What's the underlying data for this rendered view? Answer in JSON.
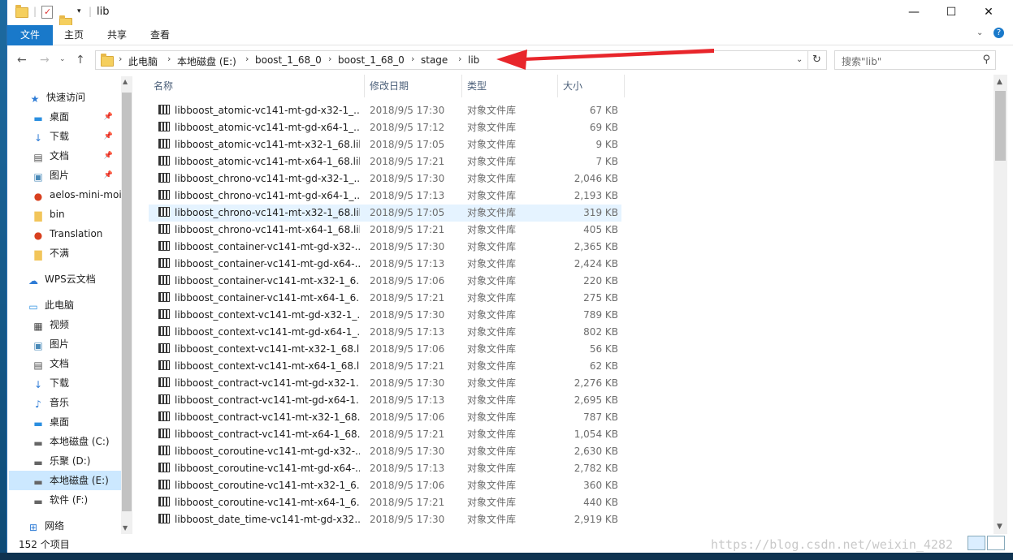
{
  "window": {
    "title": "lib",
    "minimize": "—",
    "maximize": "☐",
    "close": "✕"
  },
  "ribbon": {
    "tabs": [
      "文件",
      "主页",
      "共享",
      "查看"
    ]
  },
  "address": {
    "crumbs": [
      "此电脑",
      "本地磁盘 (E:)",
      "boost_1_68_0",
      "boost_1_68_0",
      "stage",
      "lib"
    ],
    "search_placeholder": "搜索\"lib\""
  },
  "sidebar": {
    "items": [
      {
        "label": "快速访问",
        "icon": "star-icon"
      },
      {
        "label": "桌面",
        "icon": "desktop-icon",
        "pinned": true
      },
      {
        "label": "下载",
        "icon": "download-icon",
        "pinned": true
      },
      {
        "label": "文档",
        "icon": "document-icon",
        "pinned": true
      },
      {
        "label": "图片",
        "icon": "picture-icon",
        "pinned": true
      },
      {
        "label": "aelos-mini-moi",
        "icon": "app-folder-icon"
      },
      {
        "label": "bin",
        "icon": "folder-icon"
      },
      {
        "label": "Translation",
        "icon": "app-folder-icon"
      },
      {
        "label": "不满",
        "icon": "folder-icon"
      },
      {
        "label": "WPS云文档",
        "icon": "cloud-icon"
      },
      {
        "label": "此电脑",
        "icon": "computer-icon"
      },
      {
        "label": "视频",
        "icon": "video-icon"
      },
      {
        "label": "图片",
        "icon": "picture-icon"
      },
      {
        "label": "文档",
        "icon": "document-icon"
      },
      {
        "label": "下载",
        "icon": "download-icon"
      },
      {
        "label": "音乐",
        "icon": "music-icon"
      },
      {
        "label": "桌面",
        "icon": "desktop-icon"
      },
      {
        "label": "本地磁盘 (C:)",
        "icon": "drive-icon"
      },
      {
        "label": "乐聚 (D:)",
        "icon": "drive-icon"
      },
      {
        "label": "本地磁盘 (E:)",
        "icon": "drive-icon",
        "selected": true
      },
      {
        "label": "软件 (F:)",
        "icon": "drive-icon"
      },
      {
        "label": "网络",
        "icon": "network-icon"
      }
    ]
  },
  "columns": {
    "name": "名称",
    "date": "修改日期",
    "type": "类型",
    "size": "大小"
  },
  "files": [
    {
      "name": "libboost_atomic-vc141-mt-gd-x32-1_...",
      "date": "2018/9/5 17:30",
      "type": "对象文件库",
      "size": "67 KB"
    },
    {
      "name": "libboost_atomic-vc141-mt-gd-x64-1_...",
      "date": "2018/9/5 17:12",
      "type": "对象文件库",
      "size": "69 KB"
    },
    {
      "name": "libboost_atomic-vc141-mt-x32-1_68.lib",
      "date": "2018/9/5 17:05",
      "type": "对象文件库",
      "size": "9 KB"
    },
    {
      "name": "libboost_atomic-vc141-mt-x64-1_68.lib",
      "date": "2018/9/5 17:21",
      "type": "对象文件库",
      "size": "7 KB"
    },
    {
      "name": "libboost_chrono-vc141-mt-gd-x32-1_...",
      "date": "2018/9/5 17:30",
      "type": "对象文件库",
      "size": "2,046 KB"
    },
    {
      "name": "libboost_chrono-vc141-mt-gd-x64-1_...",
      "date": "2018/9/5 17:13",
      "type": "对象文件库",
      "size": "2,193 KB"
    },
    {
      "name": "libboost_chrono-vc141-mt-x32-1_68.lib",
      "date": "2018/9/5 17:05",
      "type": "对象文件库",
      "size": "319 KB",
      "hover": true
    },
    {
      "name": "libboost_chrono-vc141-mt-x64-1_68.lib",
      "date": "2018/9/5 17:21",
      "type": "对象文件库",
      "size": "405 KB"
    },
    {
      "name": "libboost_container-vc141-mt-gd-x32-...",
      "date": "2018/9/5 17:30",
      "type": "对象文件库",
      "size": "2,365 KB"
    },
    {
      "name": "libboost_container-vc141-mt-gd-x64-...",
      "date": "2018/9/5 17:13",
      "type": "对象文件库",
      "size": "2,424 KB"
    },
    {
      "name": "libboost_container-vc141-mt-x32-1_6...",
      "date": "2018/9/5 17:06",
      "type": "对象文件库",
      "size": "220 KB"
    },
    {
      "name": "libboost_container-vc141-mt-x64-1_6...",
      "date": "2018/9/5 17:21",
      "type": "对象文件库",
      "size": "275 KB"
    },
    {
      "name": "libboost_context-vc141-mt-gd-x32-1_...",
      "date": "2018/9/5 17:30",
      "type": "对象文件库",
      "size": "789 KB"
    },
    {
      "name": "libboost_context-vc141-mt-gd-x64-1_...",
      "date": "2018/9/5 17:13",
      "type": "对象文件库",
      "size": "802 KB"
    },
    {
      "name": "libboost_context-vc141-mt-x32-1_68.lib",
      "date": "2018/9/5 17:06",
      "type": "对象文件库",
      "size": "56 KB"
    },
    {
      "name": "libboost_context-vc141-mt-x64-1_68.lib",
      "date": "2018/9/5 17:21",
      "type": "对象文件库",
      "size": "62 KB"
    },
    {
      "name": "libboost_contract-vc141-mt-gd-x32-1...",
      "date": "2018/9/5 17:30",
      "type": "对象文件库",
      "size": "2,276 KB"
    },
    {
      "name": "libboost_contract-vc141-mt-gd-x64-1...",
      "date": "2018/9/5 17:13",
      "type": "对象文件库",
      "size": "2,695 KB"
    },
    {
      "name": "libboost_contract-vc141-mt-x32-1_68....",
      "date": "2018/9/5 17:06",
      "type": "对象文件库",
      "size": "787 KB"
    },
    {
      "name": "libboost_contract-vc141-mt-x64-1_68....",
      "date": "2018/9/5 17:21",
      "type": "对象文件库",
      "size": "1,054 KB"
    },
    {
      "name": "libboost_coroutine-vc141-mt-gd-x32-...",
      "date": "2018/9/5 17:30",
      "type": "对象文件库",
      "size": "2,630 KB"
    },
    {
      "name": "libboost_coroutine-vc141-mt-gd-x64-...",
      "date": "2018/9/5 17:13",
      "type": "对象文件库",
      "size": "2,782 KB"
    },
    {
      "name": "libboost_coroutine-vc141-mt-x32-1_6...",
      "date": "2018/9/5 17:06",
      "type": "对象文件库",
      "size": "360 KB"
    },
    {
      "name": "libboost_coroutine-vc141-mt-x64-1_6...",
      "date": "2018/9/5 17:21",
      "type": "对象文件库",
      "size": "440 KB"
    },
    {
      "name": "libboost_date_time-vc141-mt-gd-x32...",
      "date": "2018/9/5 17:30",
      "type": "对象文件库",
      "size": "2,919 KB"
    }
  ],
  "status": {
    "item_count": "152 个项目"
  },
  "watermark": "https://blog.csdn.net/weixin_4282",
  "colors": {
    "accent": "#1979ca",
    "selected": "#cce8ff",
    "hover": "#e5f3ff",
    "annotation_arrow": "#e8262b"
  }
}
